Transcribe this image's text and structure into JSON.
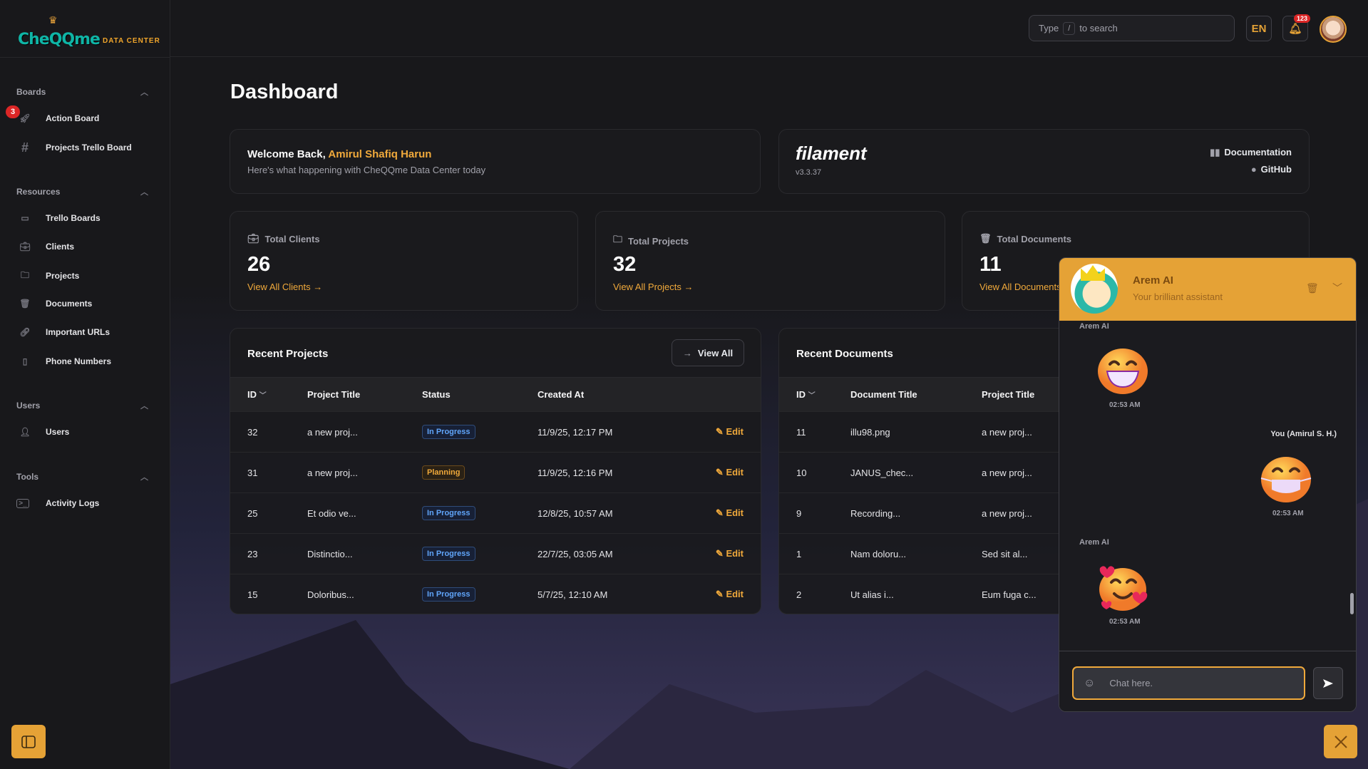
{
  "app": {
    "logo_main": "CheQQme",
    "logo_sub": "DATA CENTER"
  },
  "sidebar": {
    "groups": [
      {
        "label": "Boards",
        "items": [
          {
            "label": "Action Board",
            "badge": "3"
          },
          {
            "label": "Projects Trello Board"
          }
        ]
      },
      {
        "label": "Resources",
        "items": [
          {
            "label": "Trello Boards"
          },
          {
            "label": "Clients"
          },
          {
            "label": "Projects"
          },
          {
            "label": "Documents"
          },
          {
            "label": "Important URLs"
          },
          {
            "label": "Phone Numbers"
          }
        ]
      },
      {
        "label": "Users",
        "items": [
          {
            "label": "Users"
          }
        ]
      },
      {
        "label": "Tools",
        "items": [
          {
            "label": "Activity Logs"
          }
        ]
      }
    ]
  },
  "topbar": {
    "search_prefix": "Type",
    "search_key": "/",
    "search_suffix": "to search",
    "lang": "EN",
    "notif_count": "123"
  },
  "page": {
    "title": "Dashboard"
  },
  "welcome": {
    "greeting": "Welcome Back,",
    "name": "Amirul Shafiq Harun",
    "subtitle": "Here's what happening with CheQQme Data Center today"
  },
  "filament": {
    "name": "filament",
    "version": "v3.3.37",
    "docs": "Documentation",
    "github": "GitHub"
  },
  "stats": [
    {
      "label": "Total Clients",
      "value": "26",
      "link": "View All Clients →"
    },
    {
      "label": "Total Projects",
      "value": "32",
      "link": "View All Projects →"
    },
    {
      "label": "Total Documents",
      "value": "11",
      "link": "View All Documents →"
    }
  ],
  "recent_projects": {
    "title": "Recent Projects",
    "view_all": "View All",
    "columns": [
      "ID",
      "Project Title",
      "Status",
      "Created At"
    ],
    "edit_label": "Edit",
    "rows": [
      {
        "id": "32",
        "title": "a new proj...",
        "status": "In Progress",
        "created": "11/9/25, 12:17 PM"
      },
      {
        "id": "31",
        "title": "a new proj...",
        "status": "Planning",
        "created": "11/9/25, 12:16 PM"
      },
      {
        "id": "25",
        "title": "Et odio ve...",
        "status": "In Progress",
        "created": "12/8/25, 10:57 AM"
      },
      {
        "id": "23",
        "title": "Distinctio...",
        "status": "In Progress",
        "created": "22/7/25, 03:05 AM"
      },
      {
        "id": "15",
        "title": "Doloribus...",
        "status": "In Progress",
        "created": "5/7/25, 12:10 AM"
      }
    ]
  },
  "recent_documents": {
    "title": "Recent Documents",
    "columns": [
      "ID",
      "Document Title",
      "Project Title"
    ],
    "rows": [
      {
        "id": "11",
        "title": "illu98.png",
        "project": "a new proj..."
      },
      {
        "id": "10",
        "title": "JANUS_chec...",
        "project": "a new proj..."
      },
      {
        "id": "9",
        "title": "Recording...",
        "project": "a new proj..."
      },
      {
        "id": "1",
        "title": "Nam doloru...",
        "project": "Sed sit al..."
      },
      {
        "id": "2",
        "title": "Ut alias i...",
        "project": "Eum fuga c..."
      }
    ]
  },
  "chat": {
    "bot_name": "Arem AI",
    "bot_tagline": "Your brilliant assistant",
    "messages": [
      {
        "sender": "Arem AI",
        "emoji": "grinning-face",
        "time": "02:53 AM"
      },
      {
        "sender": "You (Amirul S. H.)",
        "emoji": "face-with-mask",
        "time": "02:53 AM"
      },
      {
        "sender": "Arem AI",
        "emoji": "smiling-face-with-hearts",
        "time": "02:53 AM"
      }
    ],
    "placeholder": "Chat here."
  },
  "colors": {
    "accent": "#e5a236",
    "bg": "#18181b",
    "blue": "#60a5fa",
    "danger": "#dc2626"
  }
}
